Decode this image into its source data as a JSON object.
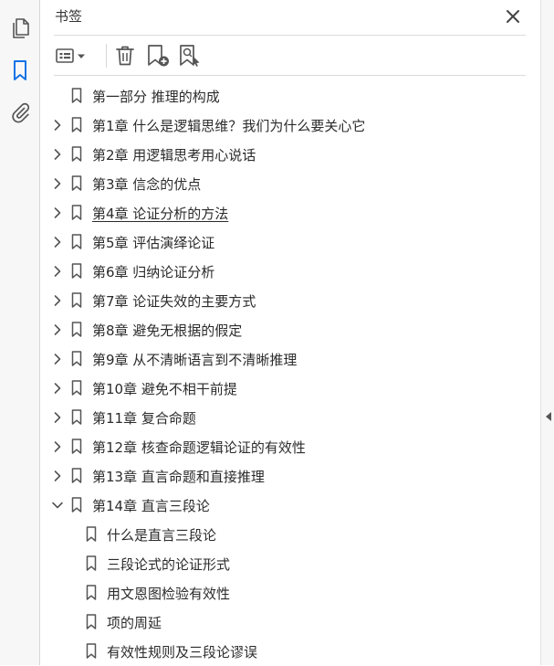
{
  "panel": {
    "title": "书签"
  },
  "colors": {
    "accent": "#1473e6",
    "icon": "#555555",
    "text": "#2b2b2b"
  },
  "left_rail": [
    "pages-icon",
    "bookmarks-icon",
    "attachments-icon"
  ],
  "toolbar": [
    "options-menu-icon",
    "delete-bookmark-icon",
    "new-bookmark-icon",
    "find-bookmark-icon"
  ],
  "bookmarks": [
    {
      "label": "第一部分  推理的构成",
      "level": 0,
      "expander": "none"
    },
    {
      "label": "第1章  什么是逻辑思维？我们为什么要关心它",
      "level": 0,
      "expander": "collapsed"
    },
    {
      "label": "第2章  用逻辑思考用心说话",
      "level": 0,
      "expander": "collapsed"
    },
    {
      "label": "第3章  信念的优点",
      "level": 0,
      "expander": "collapsed"
    },
    {
      "label": "第4章  论证分析的方法",
      "level": 0,
      "expander": "collapsed",
      "underlined": true
    },
    {
      "label": "第5章  评估演绎论证",
      "level": 0,
      "expander": "collapsed"
    },
    {
      "label": "第6章  归纳论证分析",
      "level": 0,
      "expander": "collapsed"
    },
    {
      "label": "第7章  论证失效的主要方式",
      "level": 0,
      "expander": "collapsed"
    },
    {
      "label": "第8章  避免无根据的假定",
      "level": 0,
      "expander": "collapsed"
    },
    {
      "label": "第9章  从不清晰语言到不清晰推理",
      "level": 0,
      "expander": "collapsed"
    },
    {
      "label": "第10章  避免不相干前提",
      "level": 0,
      "expander": "collapsed"
    },
    {
      "label": "第11章  复合命题",
      "level": 0,
      "expander": "collapsed"
    },
    {
      "label": "第12章  核查命题逻辑论证的有效性",
      "level": 0,
      "expander": "collapsed"
    },
    {
      "label": "第13章  直言命题和直接推理",
      "level": 0,
      "expander": "collapsed"
    },
    {
      "label": "第14章  直言三段论",
      "level": 0,
      "expander": "expanded"
    },
    {
      "label": "什么是直言三段论",
      "level": 1,
      "expander": "none"
    },
    {
      "label": "三段论式的论证形式",
      "level": 1,
      "expander": "none"
    },
    {
      "label": "用文恩图检验有效性",
      "level": 1,
      "expander": "none"
    },
    {
      "label": "项的周延",
      "level": 1,
      "expander": "none"
    },
    {
      "label": "有效性规则及三段论谬误",
      "level": 1,
      "expander": "none"
    }
  ]
}
